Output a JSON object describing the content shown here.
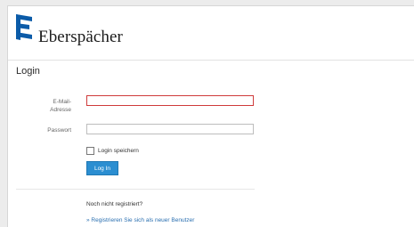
{
  "brand": {
    "name": "Eberspächer",
    "logo_icon": "eberspaecher-e-logo",
    "logo_color": "#0b5ba8"
  },
  "login": {
    "title": "Login",
    "email_label": "E-Mail-Adresse",
    "email_value": "",
    "password_label": "Passwort",
    "password_value": "",
    "remember_label": "Login speichern",
    "remember_checked": false,
    "button_label": "Log In",
    "button_color": "#2b8ed1",
    "error_border_color": "#cf3b3b"
  },
  "register": {
    "prompt": "Noch nicht registriert?",
    "link_label": "» Registrieren Sie sich als neuer Benutzer"
  }
}
